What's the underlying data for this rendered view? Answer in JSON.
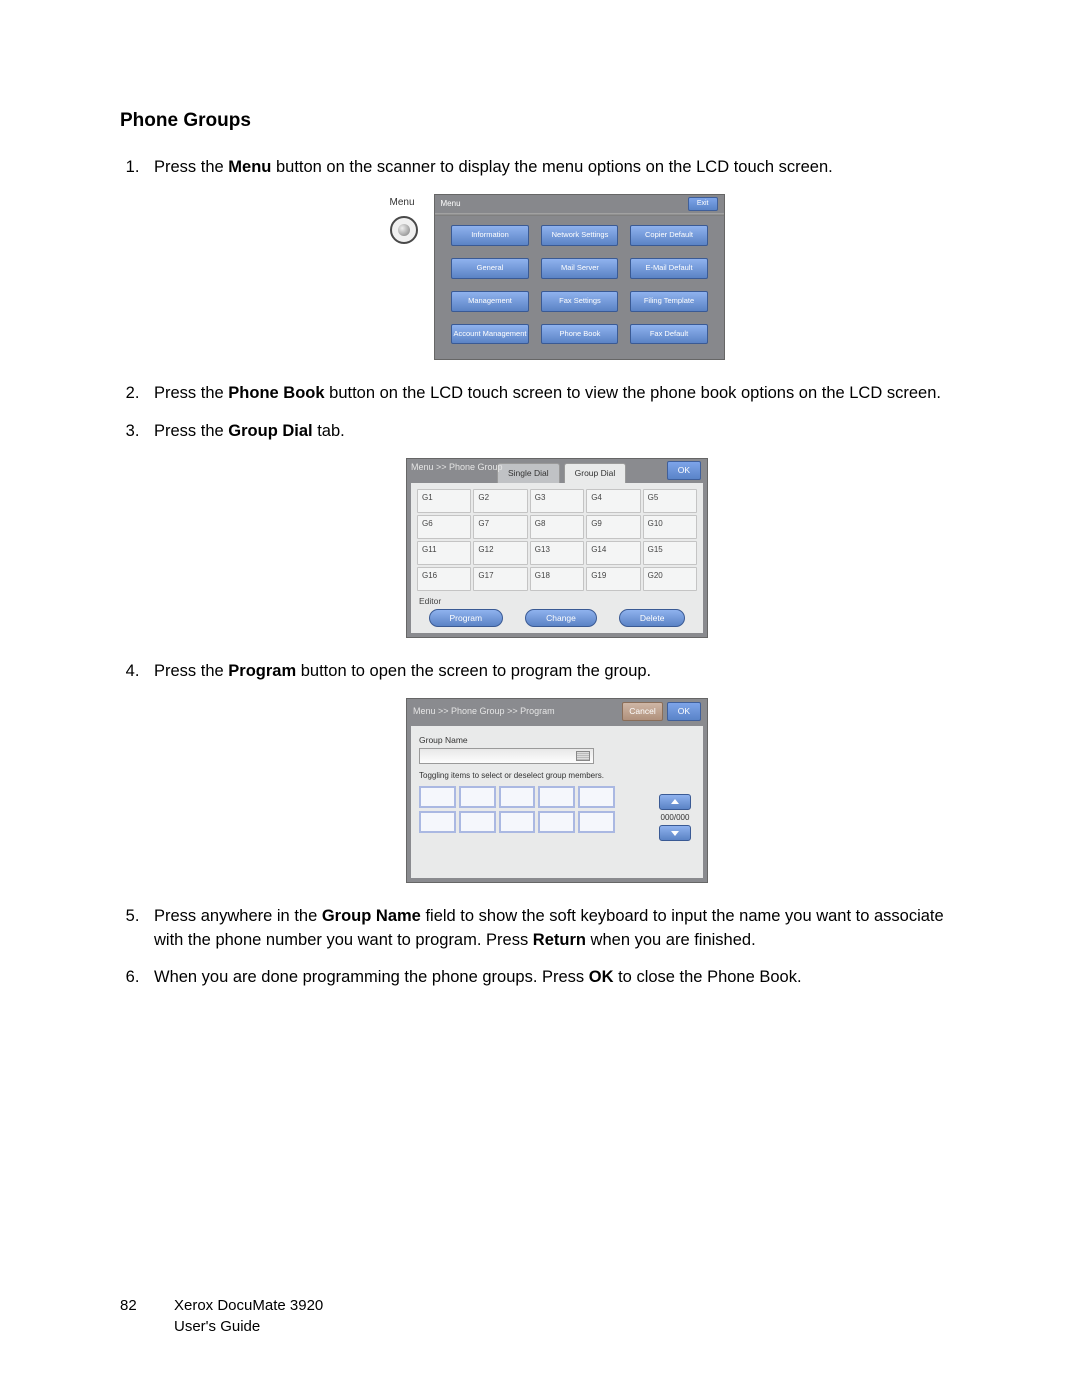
{
  "section_title": "Phone Groups",
  "steps": {
    "s1": {
      "pre": "Press the ",
      "bold": "Menu",
      "post": " button on the scanner to display the menu options on the LCD touch screen."
    },
    "s2": {
      "pre": "Press the ",
      "bold": "Phone Book",
      "post": " button on the LCD touch screen to view the phone book options on the LCD screen."
    },
    "s3": {
      "pre": "Press the ",
      "bold": "Group Dial",
      "post": " tab."
    },
    "s4": {
      "pre": "Press the ",
      "bold": "Program",
      "post": " button to open the screen to program the group."
    },
    "s5": {
      "pre": "Press anywhere in the ",
      "bold": "Group Name",
      "mid": " field to show the soft keyboard to input the name you want to associate with the phone number you want to program. Press ",
      "bold2": "Return",
      "post": " when you are finished."
    },
    "s6": {
      "pre": "When you are done programming the phone groups. Press ",
      "bold": "OK",
      "post": " to close the Phone Book."
    }
  },
  "lcd_menu": {
    "side_label": "Menu",
    "header": "Menu",
    "exit": "Exit",
    "buttons": [
      "Information",
      "Network Settings",
      "Copier Default",
      "General",
      "Mail Server",
      "E-Mail Default",
      "Management",
      "Fax Settings",
      "Filing Template",
      "Account Management",
      "Phone Book",
      "Fax Default"
    ]
  },
  "phone_group": {
    "breadcrumb": "Menu >> Phone Group",
    "tab_single": "Single Dial",
    "tab_group": "Group Dial",
    "ok": "OK",
    "cells": [
      "G1",
      "G2",
      "G3",
      "G4",
      "G5",
      "G6",
      "G7",
      "G8",
      "G9",
      "G10",
      "G11",
      "G12",
      "G13",
      "G14",
      "G15",
      "G16",
      "G17",
      "G18",
      "G19",
      "G20"
    ],
    "editor_label": "Editor",
    "actions": {
      "program": "Program",
      "change": "Change",
      "delete": "Delete"
    }
  },
  "program": {
    "breadcrumb": "Menu >> Phone Group >> Program",
    "cancel": "Cancel",
    "ok": "OK",
    "group_name_label": "Group Name",
    "hint": "Toggling items to select or deselect group members.",
    "pager": "000/000"
  },
  "footer": {
    "page_number": "82",
    "product": "Xerox DocuMate 3920",
    "doc": "User's Guide"
  }
}
